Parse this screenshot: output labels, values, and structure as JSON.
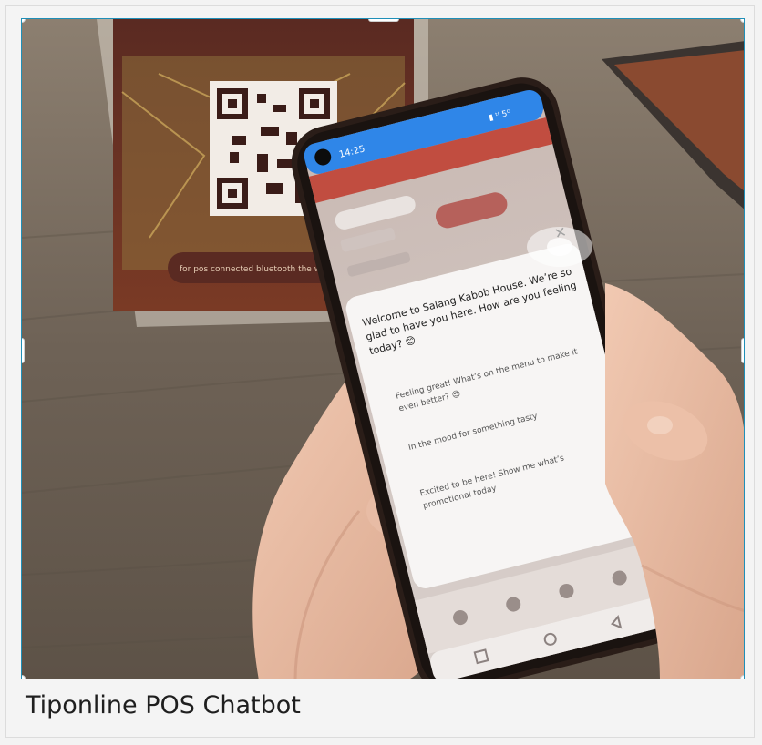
{
  "caption": "Tiponline POS Chatbot",
  "photo": {
    "sign_text": "for pos connected bluetooth the wireless",
    "phone": {
      "status_time": "14:25",
      "status_icons": "▮ ᵗˡ 5ᴳ",
      "chat": {
        "greeting": "Welcome to Salang Kabob House. We’re so glad to have you here. How are you feeling today? 😊",
        "greeting_lines": [
          "Welcome to Salang Kabob House. We’re so",
          "glad to have you here. How are you feeling",
          "today? 😊"
        ],
        "options": [
          {
            "lines": [
              "Feeling great! What’s on the menu to make it",
              "even better? 😎"
            ]
          },
          {
            "lines": [
              "In the mood for something tasty"
            ]
          },
          {
            "lines": [
              "Excited to be here! Show me what’s",
              "promotional today"
            ]
          }
        ],
        "close_label": "✕"
      }
    },
    "colors": {
      "status_bar": "#2f86e8",
      "app_header": "#c0392b",
      "table": "#6f6357",
      "frame_border": "#1f8fb8"
    }
  }
}
